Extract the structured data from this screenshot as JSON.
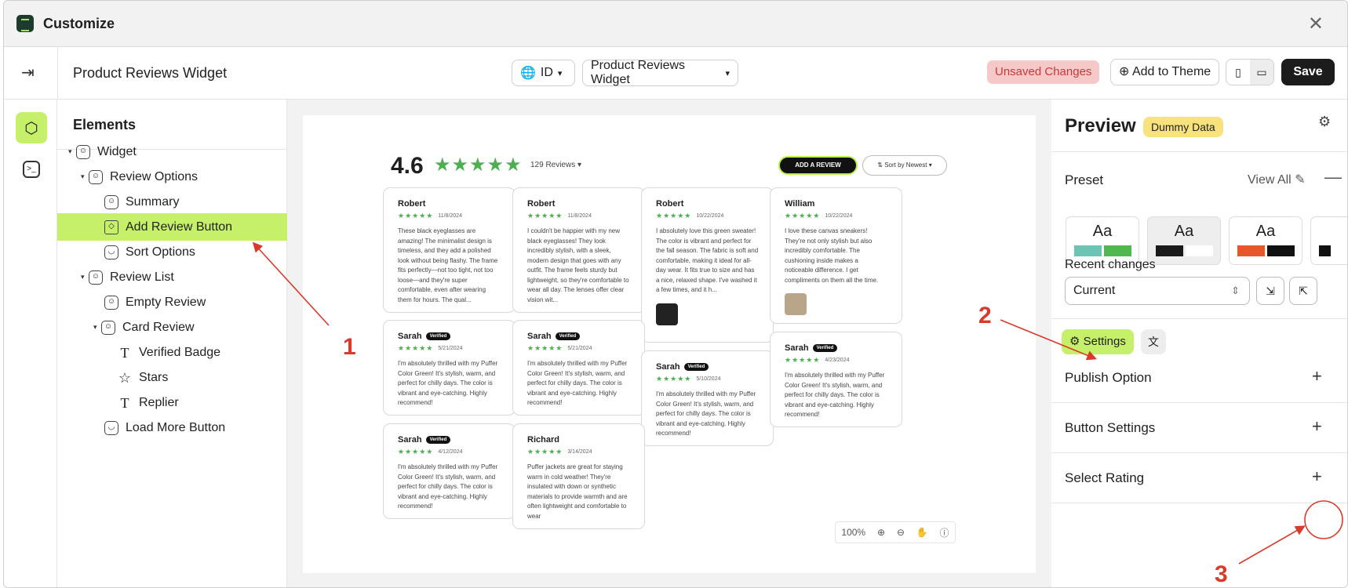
{
  "window": {
    "title": "Customize"
  },
  "toolbar": {
    "page_name": "Product Reviews Widget",
    "language": "ID",
    "template": "Product Reviews Widget",
    "status": "Unsaved Changes",
    "add_to_theme": "Add to Theme",
    "save": "Save"
  },
  "elements": {
    "heading": "Elements",
    "tree": [
      "Widget",
      "Review Options",
      "Summary",
      "Add Review Button",
      "Sort Options",
      "Review List",
      "Empty Review",
      "Card Review",
      "Verified Badge",
      "Stars",
      "Replier",
      "Load More Button"
    ],
    "selected": "Add Review Button"
  },
  "preview_widget": {
    "rating": "4.6",
    "stars": "★★★★★",
    "review_count": "129 Reviews",
    "add_review": "ADD A REVIEW",
    "sort": "Sort by Newest",
    "verified": "Verified",
    "reviews": [
      {
        "name": "Robert",
        "date": "11/8/2024",
        "text": "These black eyeglasses are amazing! The minimalist design is timeless, and they add a polished look without being flashy. The frame fits perfectly—not too tight, not too loose—and they're super comfortable, even after wearing them for hours. The qual..."
      },
      {
        "name": "Robert",
        "date": "11/8/2024",
        "text": "I couldn't be happier with my new black eyeglasses! They look incredibly stylish, with a sleek, modern design that goes with any outfit. The frame feels sturdy but lightweight, so they're comfortable to wear all day. The lenses offer clear vision wit..."
      },
      {
        "name": "Robert",
        "date": "10/22/2024",
        "text": "I absolutely love this green sweater! The color is vibrant and perfect for the fall season. The fabric is soft and comfortable, making it ideal for all-day wear. It fits true to size and has a nice, relaxed shape. I've washed it a few times, and it h..."
      },
      {
        "name": "William",
        "date": "10/22/2024",
        "text": "I love these canvas sneakers! They're not only stylish but also incredibly comfortable. The cushioning inside makes a noticeable difference. I get compliments on them all the time."
      },
      {
        "name": "Sarah",
        "date": "5/21/2024",
        "text": "I'm absolutely thrilled with my Puffer Color Green! It's stylish, warm, and perfect for chilly days. The color is vibrant and eye-catching. Highly recommend!"
      },
      {
        "name": "Sarah",
        "date": "5/21/2024",
        "text": "I'm absolutely thrilled with my Puffer Color Green! It's stylish, warm, and perfect for chilly days. The color is vibrant and eye-catching. Highly recommend!"
      },
      {
        "name": "Sarah",
        "date": "5/10/2024",
        "text": "I'm absolutely thrilled with my Puffer Color Green! It's stylish, warm, and perfect for chilly days. The color is vibrant and eye-catching. Highly recommend!"
      },
      {
        "name": "Sarah",
        "date": "4/23/2024",
        "text": "I'm absolutely thrilled with my Puffer Color Green! It's stylish, warm, and perfect for chilly days. The color is vibrant and eye-catching. Highly recommend!"
      },
      {
        "name": "Sarah",
        "date": "4/12/2024",
        "text": "I'm absolutely thrilled with my Puffer Color Green! It's stylish, warm, and perfect for chilly days. The color is vibrant and eye-catching. Highly recommend!"
      },
      {
        "name": "Richard",
        "date": "3/14/2024",
        "text": "Puffer jackets are great for staying warm in cold weather! They're insulated with down or synthetic materials to provide warmth and are often lightweight and comfortable to wear"
      }
    ],
    "zoom": "100%"
  },
  "panel": {
    "title": "Preview",
    "badge": "Dummy Data",
    "preset": "Preset",
    "view_all": "View All",
    "aa": "Aa",
    "recent_changes": "Recent changes",
    "current": "Current",
    "settings": "Settings",
    "sections": [
      "Publish Option",
      "Button Settings",
      "Select Rating"
    ]
  },
  "annotations": [
    "1",
    "2",
    "3"
  ],
  "colors": {
    "accent": "#c7f06a",
    "star": "#4caf50",
    "annotation": "#d93a2b",
    "unsaved_bg": "#f6c9c8",
    "dummy_bg": "#f7e27d"
  }
}
